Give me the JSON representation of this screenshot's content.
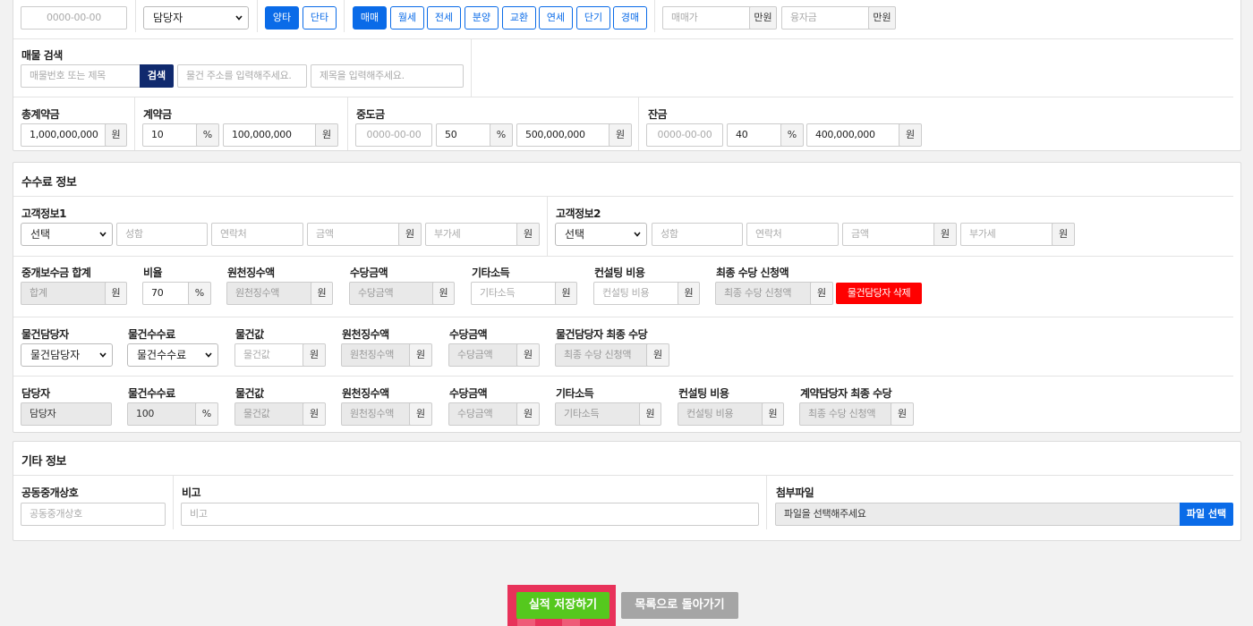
{
  "top_row": {
    "date_placeholder": "0000-00-00",
    "manager_select": "담당자",
    "sides": [
      {
        "label": "양타",
        "active": true
      },
      {
        "label": "단타",
        "active": false
      }
    ],
    "deal_types": [
      {
        "label": "매매",
        "active": true
      },
      {
        "label": "월세",
        "active": false
      },
      {
        "label": "전세",
        "active": false
      },
      {
        "label": "분양",
        "active": false
      },
      {
        "label": "교환",
        "active": false
      },
      {
        "label": "연세",
        "active": false
      },
      {
        "label": "단기",
        "active": false
      },
      {
        "label": "경매",
        "active": false
      }
    ],
    "sale_price_placeholder": "매매가",
    "sale_price_unit": "만원",
    "loan_placeholder": "융자금",
    "loan_unit": "만원"
  },
  "search": {
    "label": "매물 검색",
    "number_placeholder": "매물번호 또는 제목",
    "button": "검색",
    "address_placeholder": "물건 주소를 입력해주세요.",
    "title_placeholder": "제목을 입력해주세요."
  },
  "payment": {
    "total_label": "총계약금",
    "total_value": "1,000,000,000",
    "total_unit": "원",
    "deposit_label": "계약금",
    "deposit_pct": "10",
    "deposit_pct_unit": "%",
    "deposit_value": "100,000,000",
    "deposit_unit": "원",
    "middle_label": "중도금",
    "middle_date_placeholder": "0000-00-00",
    "middle_pct": "50",
    "middle_pct_unit": "%",
    "middle_value": "500,000,000",
    "middle_unit": "원",
    "balance_label": "잔금",
    "balance_date_placeholder": "0000-00-00",
    "balance_pct": "40",
    "balance_pct_unit": "%",
    "balance_value": "400,000,000",
    "balance_unit": "원"
  },
  "fee": {
    "title": "수수료 정보",
    "customer1": {
      "label": "고객정보1",
      "select": "선택",
      "name_placeholder": "성함",
      "contact_placeholder": "연락처",
      "amount_placeholder": "금액",
      "amount_unit": "원",
      "vat_placeholder": "부가세",
      "vat_unit": "원"
    },
    "customer2": {
      "label": "고객정보2",
      "select": "선택",
      "name_placeholder": "성함",
      "contact_placeholder": "연락처",
      "amount_placeholder": "금액",
      "amount_unit": "원",
      "vat_placeholder": "부가세",
      "vat_unit": "원"
    },
    "summary": {
      "total_label": "중개보수금 합계",
      "total_placeholder": "합계",
      "total_unit": "원",
      "ratio_label": "비율",
      "ratio_value": "70",
      "ratio_unit": "%",
      "withholding_label": "원천징수액",
      "withholding_placeholder": "원천징수액",
      "withholding_unit": "원",
      "allowance_label": "수당금액",
      "allowance_placeholder": "수당금액",
      "allowance_unit": "원",
      "other_label": "기타소득",
      "other_placeholder": "기타소득",
      "other_unit": "원",
      "consulting_label": "컨설팅 비용",
      "consulting_placeholder": "컨설팅 비용",
      "consulting_unit": "원",
      "final_label": "최종 수당 신청액",
      "final_placeholder": "최종 수당 신청액",
      "final_unit": "원",
      "delete_button": "물건담당자 삭제"
    },
    "property_agent": {
      "agent_label": "물건담당자",
      "agent_select": "물건담당자",
      "fee_label": "물건수수료",
      "fee_select": "물건수수료",
      "value_label": "물건값",
      "value_placeholder": "물건값",
      "value_unit": "원",
      "withholding_label": "원천징수액",
      "withholding_placeholder": "원천징수액",
      "withholding_unit": "원",
      "allowance_label": "수당금액",
      "allowance_placeholder": "수당금액",
      "allowance_unit": "원",
      "final_label": "물건담당자 최종 수당",
      "final_placeholder": "최종 수당 신청액",
      "final_unit": "원"
    },
    "contract_agent": {
      "agent_label": "담당자",
      "agent_value": "담당자",
      "fee_label": "물건수수료",
      "fee_value": "100",
      "fee_unit": "%",
      "value_label": "물건값",
      "value_placeholder": "물건값",
      "value_unit": "원",
      "withholding_label": "원천징수액",
      "withholding_placeholder": "원천징수액",
      "withholding_unit": "원",
      "allowance_label": "수당금액",
      "allowance_placeholder": "수당금액",
      "allowance_unit": "원",
      "other_label": "기타소득",
      "other_placeholder": "기타소득",
      "other_unit": "원",
      "consulting_label": "컨설팅 비용",
      "consulting_placeholder": "컨설팅 비용",
      "consulting_unit": "원",
      "final_label": "계약담당자 최종 수당",
      "final_placeholder": "최종 수당 신청액",
      "final_unit": "원"
    }
  },
  "other": {
    "title": "기타 정보",
    "joint_label": "공동중개상호",
    "joint_placeholder": "공동중개상호",
    "note_label": "비고",
    "note_placeholder": "비고",
    "file_label": "첨부파일",
    "file_text": "파일을 선택해주세요",
    "file_button": "파일 선택"
  },
  "actions": {
    "save": "실적 저장하기",
    "back": "목록으로 돌아가기"
  },
  "colors": {
    "accent": "#0a6be8",
    "save": "#55c81e",
    "back": "#a5a5a5",
    "delete": "#ff0000",
    "highlight": "#e8325a"
  }
}
